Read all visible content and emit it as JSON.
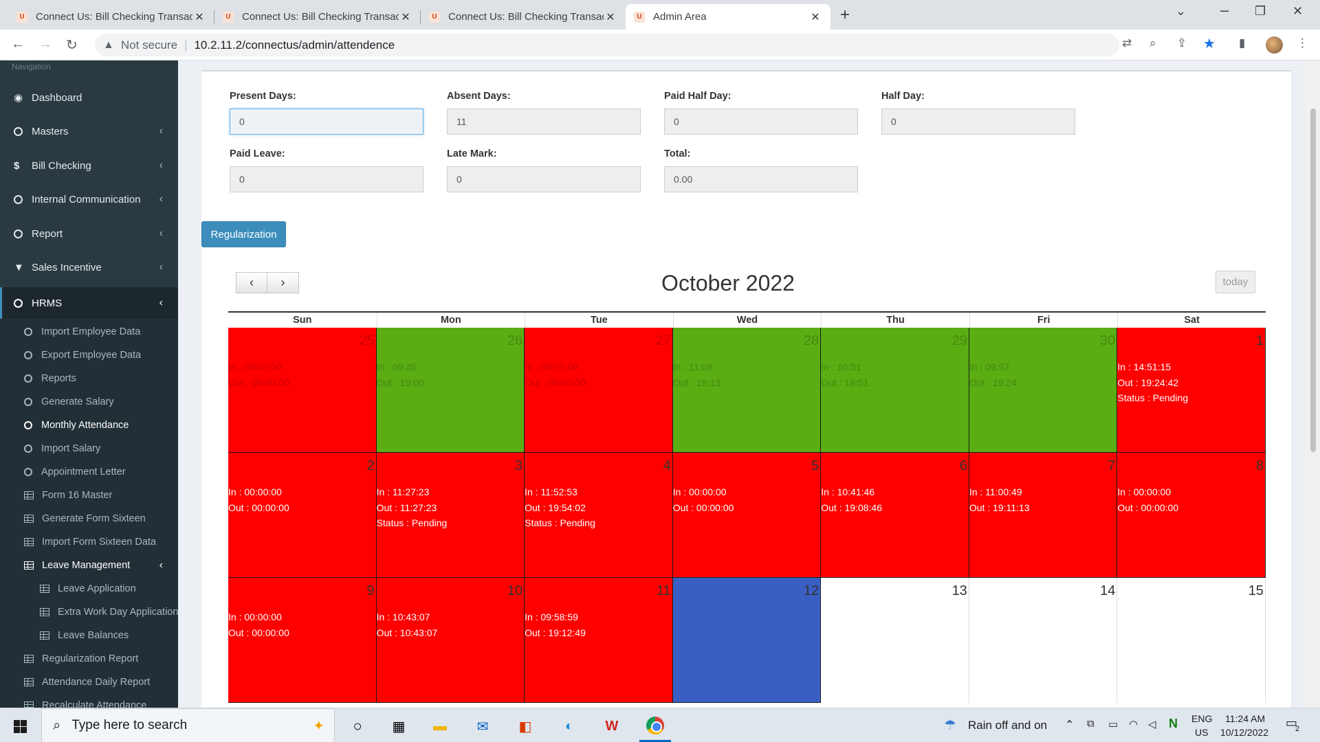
{
  "browser": {
    "tabs": [
      {
        "title": "Connect Us: Bill Checking Transac",
        "active": false
      },
      {
        "title": "Connect Us: Bill Checking Transac",
        "active": false
      },
      {
        "title": "Connect Us: Bill Checking Transac",
        "active": false
      },
      {
        "title": "Admin Area",
        "active": true
      }
    ],
    "not_secure": "Not secure",
    "url": "10.2.11.2/connectus/admin/attendence"
  },
  "sidebar": {
    "nav_label": "Navigation",
    "items": [
      {
        "label": "Dashboard",
        "icon": "dashboard-icon"
      },
      {
        "label": "Masters",
        "icon": "circle-icon"
      },
      {
        "label": "Bill Checking",
        "icon": "dollar-icon"
      },
      {
        "label": "Internal Communication",
        "icon": "circle-icon"
      },
      {
        "label": "Report",
        "icon": "circle-icon"
      },
      {
        "label": "Sales Incentive",
        "icon": "filter-icon"
      },
      {
        "label": "HRMS",
        "icon": "circle-icon"
      }
    ],
    "hrms_sub": [
      {
        "label": "Import Employee Data"
      },
      {
        "label": "Export Employee Data"
      },
      {
        "label": "Reports"
      },
      {
        "label": "Generate Salary"
      },
      {
        "label": "Monthly Attendance"
      },
      {
        "label": "Import Salary"
      },
      {
        "label": "Appointment Letter"
      },
      {
        "label": "Form 16 Master"
      },
      {
        "label": "Generate Form Sixteen"
      },
      {
        "label": "Import Form Sixteen Data"
      },
      {
        "label": "Leave Management"
      },
      {
        "label": "Leave Application"
      },
      {
        "label": "Extra Work Day Application"
      },
      {
        "label": "Leave Balances"
      },
      {
        "label": "Regularization Report"
      },
      {
        "label": "Attendance Daily Report"
      },
      {
        "label": "Recalculate Attendance"
      }
    ]
  },
  "summary": {
    "present_days": {
      "label": "Present Days:",
      "value": "0"
    },
    "absent_days": {
      "label": "Absent Days:",
      "value": "11"
    },
    "paid_half_day": {
      "label": "Paid Half Day:",
      "value": "0"
    },
    "half_day": {
      "label": "Half Day:",
      "value": "0"
    },
    "paid_leave": {
      "label": "Paid Leave:",
      "value": "0"
    },
    "late_mark": {
      "label": "Late Mark:",
      "value": "0"
    },
    "total": {
      "label": "Total:",
      "value": "0.00"
    }
  },
  "regularization_label": "Regularization",
  "calendar": {
    "title": "October 2022",
    "today_label": "today",
    "weekdays": [
      "Sun",
      "Mon",
      "Tue",
      "Wed",
      "Thu",
      "Fri",
      "Sat"
    ],
    "status_colors": {
      "absent": "#ff0000",
      "present": "#5aad13",
      "today": "#3a5fc4"
    },
    "weeks": [
      [
        {
          "day": "25",
          "status": "absent",
          "other": true,
          "lines": [
            "In : 00:00:00",
            "Out : 00:00:00"
          ]
        },
        {
          "day": "26",
          "status": "present",
          "other": true,
          "lines": [
            "In : 09:45",
            "Out : 19:00"
          ]
        },
        {
          "day": "27",
          "status": "absent",
          "other": true,
          "lines": [
            "In : 00:00:00",
            "Out : 00:00:00"
          ]
        },
        {
          "day": "28",
          "status": "present",
          "other": true,
          "lines": [
            "In : 11:08",
            "Out : 19:13"
          ]
        },
        {
          "day": "29",
          "status": "present",
          "other": true,
          "lines": [
            "In : 10:51",
            "Out : 19:51"
          ]
        },
        {
          "day": "30",
          "status": "present",
          "other": true,
          "lines": [
            "In : 09:57",
            "Out : 19:24"
          ]
        },
        {
          "day": "1",
          "status": "absent",
          "other": false,
          "lines": [
            "In : 14:51:15",
            "Out : 19:24:42",
            "Status : Pending"
          ]
        }
      ],
      [
        {
          "day": "2",
          "status": "absent",
          "other": false,
          "lines": [
            "In : 00:00:00",
            "Out : 00:00:00"
          ]
        },
        {
          "day": "3",
          "status": "absent",
          "other": false,
          "lines": [
            "In : 11:27:23",
            "Out : 11:27:23",
            "Status : Pending"
          ]
        },
        {
          "day": "4",
          "status": "absent",
          "other": false,
          "lines": [
            "In : 11:52:53",
            "Out : 19:54:02",
            "Status : Pending"
          ]
        },
        {
          "day": "5",
          "status": "absent",
          "other": false,
          "lines": [
            "In : 00:00:00",
            "Out : 00:00:00"
          ]
        },
        {
          "day": "6",
          "status": "absent",
          "other": false,
          "lines": [
            "In : 10:41:46",
            "Out : 19:08:46"
          ]
        },
        {
          "day": "7",
          "status": "absent",
          "other": false,
          "lines": [
            "In : 11:00:49",
            "Out : 19:11:13"
          ]
        },
        {
          "day": "8",
          "status": "absent",
          "other": false,
          "lines": [
            "In : 00:00:00",
            "Out : 00:00:00"
          ]
        }
      ],
      [
        {
          "day": "9",
          "status": "absent",
          "other": false,
          "lines": [
            "In : 00:00:00",
            "Out : 00:00:00"
          ]
        },
        {
          "day": "10",
          "status": "absent",
          "other": false,
          "lines": [
            "In : 10:43:07",
            "Out : 10:43:07"
          ]
        },
        {
          "day": "11",
          "status": "absent",
          "other": false,
          "lines": [
            "In : 09:58:59",
            "Out : 19:12:49"
          ]
        },
        {
          "day": "12",
          "status": "today",
          "other": false,
          "lines": []
        },
        {
          "day": "13",
          "status": "none",
          "other": false,
          "lines": []
        },
        {
          "day": "14",
          "status": "none",
          "other": false,
          "lines": []
        },
        {
          "day": "15",
          "status": "none",
          "other": false,
          "lines": []
        }
      ]
    ]
  },
  "taskbar": {
    "search_placeholder": "Type here to search",
    "weather": "Rain off and on",
    "lang": "ENG",
    "region": "US",
    "time": "11:24 AM",
    "date": "10/12/2022",
    "notifications": "2"
  }
}
